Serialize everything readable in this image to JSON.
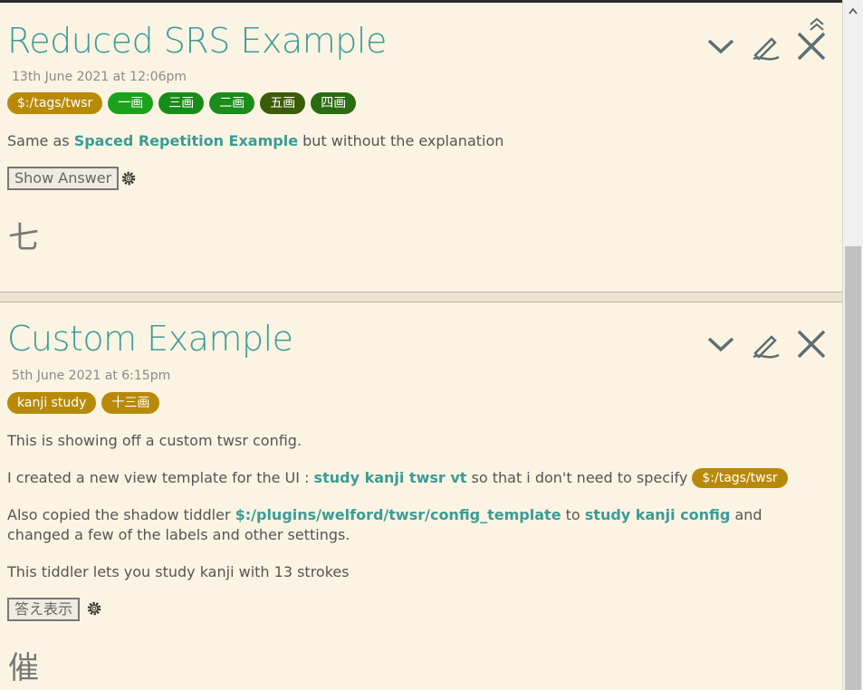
{
  "tiddlers": [
    {
      "title": "Reduced SRS Example",
      "date": "13th June 2021 at 12:06pm",
      "tags": [
        {
          "label": "$:/tags/twsr",
          "color": "#b88a0a"
        },
        {
          "label": "一画",
          "color": "#1aa31a"
        },
        {
          "label": "三画",
          "color": "#188c18"
        },
        {
          "label": "二画",
          "color": "#1a8d1a"
        },
        {
          "label": "五画",
          "color": "#3b5d0a"
        },
        {
          "label": "四画",
          "color": "#2b6c12"
        }
      ],
      "text_before_link": "Same as ",
      "link": "Spaced Repetition Example",
      "text_after_link": " but without the explanation",
      "button_label": "Show Answer",
      "card": "七"
    },
    {
      "title": "Custom Example",
      "date": "5th June 2021 at 6:15pm",
      "tags": [
        {
          "label": "kanji study",
          "color": "#b88a0a"
        },
        {
          "label": "十三画",
          "color": "#b88a0a"
        }
      ],
      "para1": "This is showing off a custom twsr config.",
      "para2_a": "I created a new view template for the UI : ",
      "para2_link": "study kanji twsr vt",
      "para2_b": " so that i don't need to specify ",
      "para2_tag": "$:/tags/twsr",
      "para3_a": "Also copied the shadow tiddler ",
      "para3_link1": "$:/plugins/welford/twsr/config_template",
      "para3_b": " to ",
      "para3_link2": "study kanji config",
      "para3_c": " and changed a few of the labels and other settings.",
      "para4": "This tiddler lets you study kanji with 13 strokes",
      "button_label": "答え表示",
      "card": "催"
    }
  ],
  "icons": {
    "collapse": "chevron-down-icon",
    "edit": "pencil-icon",
    "close": "close-icon",
    "scroll_top": "double-chevron-up-icon",
    "settings": "gear-icon"
  }
}
